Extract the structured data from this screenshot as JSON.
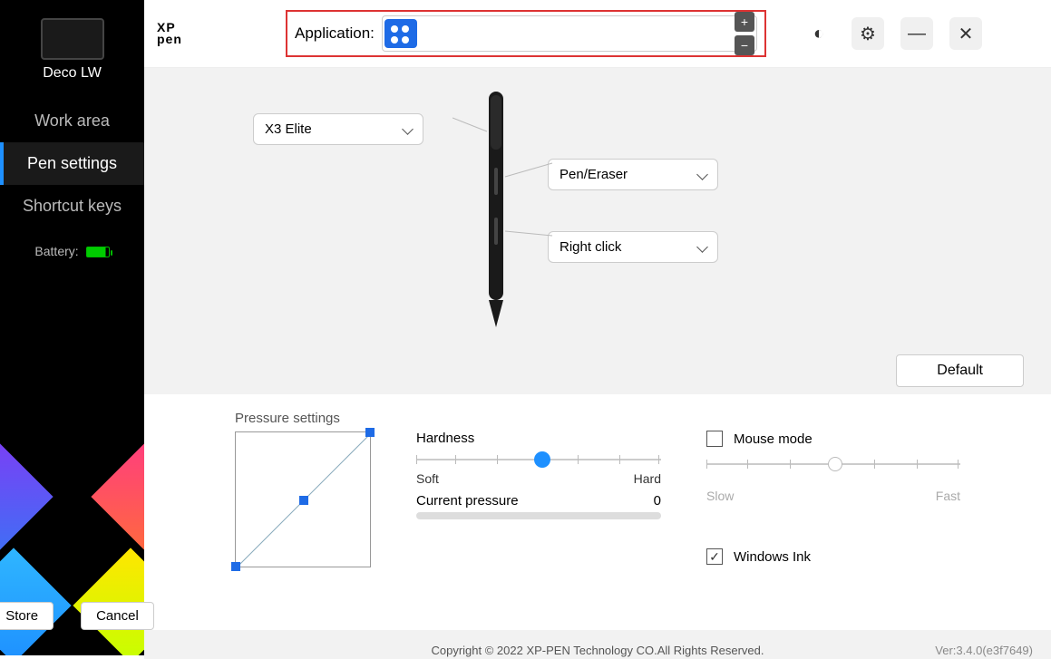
{
  "sidebar": {
    "device_name": "Deco LW",
    "nav": [
      "Work area",
      "Pen settings",
      "Shortcut keys"
    ],
    "battery_label": "Battery:",
    "store_btn": "Store",
    "cancel_btn": "Cancel"
  },
  "header": {
    "logo_line1": "XP",
    "logo_line2": "pen",
    "app_label": "Application:",
    "plus": "+",
    "minus": "−",
    "minimize": "—",
    "close": "✕"
  },
  "pen": {
    "model": "X3 Elite",
    "btn1": "Pen/Eraser",
    "btn2": "Right click",
    "default_btn": "Default"
  },
  "pressure": {
    "title": "Pressure settings",
    "hardness": "Hardness",
    "soft": "Soft",
    "hard": "Hard",
    "current_label": "Current pressure",
    "current_value": "0",
    "mouse_mode": "Mouse mode",
    "slow": "Slow",
    "fast": "Fast",
    "windows_ink": "Windows Ink"
  },
  "footer": {
    "copyright": "Copyright © 2022  XP-PEN Technology CO.All Rights Reserved.",
    "version": "Ver:3.4.0(e3f7649)"
  }
}
